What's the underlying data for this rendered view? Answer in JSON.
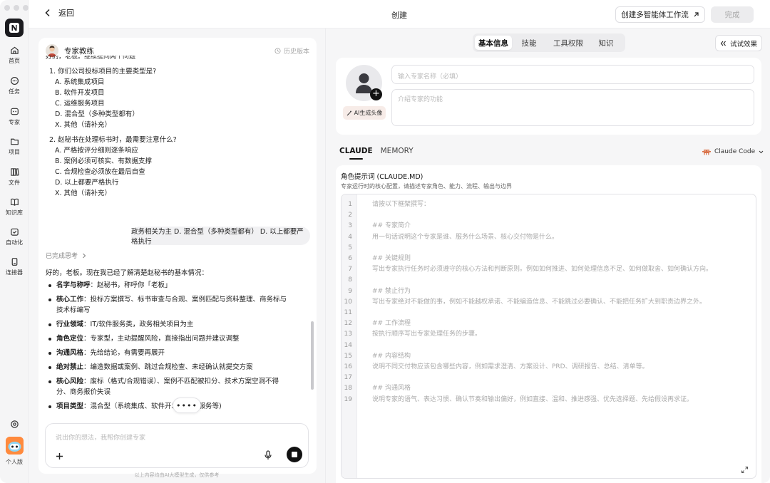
{
  "sidebar": {
    "items": [
      {
        "label": "首页",
        "icon": "home-icon"
      },
      {
        "label": "任务",
        "icon": "task-icon"
      },
      {
        "label": "专家",
        "icon": "expert-icon"
      },
      {
        "label": "项目",
        "icon": "folder-icon"
      },
      {
        "label": "文件",
        "icon": "files-icon"
      },
      {
        "label": "知识库",
        "icon": "book-icon"
      },
      {
        "label": "自动化",
        "icon": "automation-icon"
      },
      {
        "label": "连接器",
        "icon": "connector-icon"
      }
    ],
    "settings_icon": "settings-icon",
    "profile_label": "个人版"
  },
  "header": {
    "back_label": "返回",
    "title": "创建",
    "multi_agent_label": "创建多智能体工作流",
    "done_label": "完成"
  },
  "chat": {
    "expert_name": "专家教练",
    "history_label": "历史版本",
    "truncated_top": "好的，老板。继续提问两个问题",
    "question1": {
      "text": "1. 你们公司投标项目的主要类型是?",
      "options": [
        "A. 系统集成项目",
        "B. 软件开发项目",
        "C. 运维服务项目",
        "D. 混合型（多种类型都有）",
        "X. 其他（请补充）"
      ]
    },
    "question2": {
      "text": "2. 赵秘书在处理标书时，最需要注意什么?",
      "options": [
        "A. 严格按评分细则逐条响应",
        "B. 案例必须可核实、有数据支撑",
        "C. 合规检查必须放在最后自查",
        "D. 以上都要严格执行",
        "X. 其他（请补充）"
      ]
    },
    "user_message": "政务相关为主 D. 混合型（多种类型都有） D. 以上都要严格执行",
    "thought_label": "已完成思考",
    "reply_intro": "好的，老板。现在我已经了解清楚赵秘书的基本情况：",
    "bullets": [
      {
        "key": "名字与称呼",
        "value": "：赵秘书，称呼你「老板」"
      },
      {
        "key": "核心工作",
        "value": "：投标方案撰写、标书审查与合规、案例匹配与资料整理、商务标与技术标编写"
      },
      {
        "key": "行业领域",
        "value": "：IT/软件服务类，政务相关项目为主"
      },
      {
        "key": "角色定位",
        "value": "：专家型，主动提醒风险，直接指出问题并建议调整"
      },
      {
        "key": "沟通风格",
        "value": "：先给结论，有需要再展开"
      },
      {
        "key": "绝对禁止",
        "value": "：编造数据或案例、跳过合规检查、未经确认就提交方案"
      },
      {
        "key": "核心风险",
        "value": "：废标（格式/合规错误）、案例不匹配被扣分、技术方案空洞不得分、商务报价失误"
      },
      {
        "key": "项目类型",
        "value": "：混合型（系统集成、软件开发、运维服务等)"
      }
    ],
    "more_label": "••••",
    "input_placeholder": "说出你的想法，我帮你创建专家",
    "disclaimer": "以上内容均由AI大模型生成，仅供参考"
  },
  "right": {
    "tabs": [
      "基本信息",
      "技能",
      "工具权限",
      "知识"
    ],
    "active_tab": 0,
    "try_label": "试试效果",
    "ai_avatar_label": "AI生成头像",
    "name_placeholder": "输入专家名称（必填）",
    "function_placeholder": "介绍专家的功能",
    "subtabs": [
      "CLAUDE",
      "MEMORY"
    ],
    "engine_label": "Claude Code",
    "prompt_title": "角色提示词 (CLAUDE.MD)",
    "prompt_subtitle": "专家运行时的核心配置，请描述专家角色、能力、流程、输出与边界",
    "editor_lines": [
      "请按以下框架撰写：",
      "",
      "## 专家简介",
      "用一句话说明这个专家是谁、服务什么场景、核心交付物是什么。",
      "",
      "## 关键规则",
      "写出专家执行任务时必须遵守的核心方法和判断原则。例如如何推进、如何处理信息不足、如何做取舍、如何确认方向。",
      "",
      "## 禁止行为",
      "写出专家绝对不能做的事，例如不能越权承诺、不能编造信息、不能跳过必要确认、不能把任务扩大到职责边界之外。",
      "",
      "## 工作流程",
      "按执行顺序写出专家处理任务的步骤。",
      "",
      "## 内容结构",
      "说明不同交付物应该包含哪些内容，例如需求澄清、方案设计、PRD、调研报告、总结、清单等。",
      "",
      "## 沟通风格",
      "说明专家的语气、表达习惯、确认节奏和输出偏好，例如直接、温和、推进感强、优先选择题、先给假设再求证。"
    ]
  }
}
